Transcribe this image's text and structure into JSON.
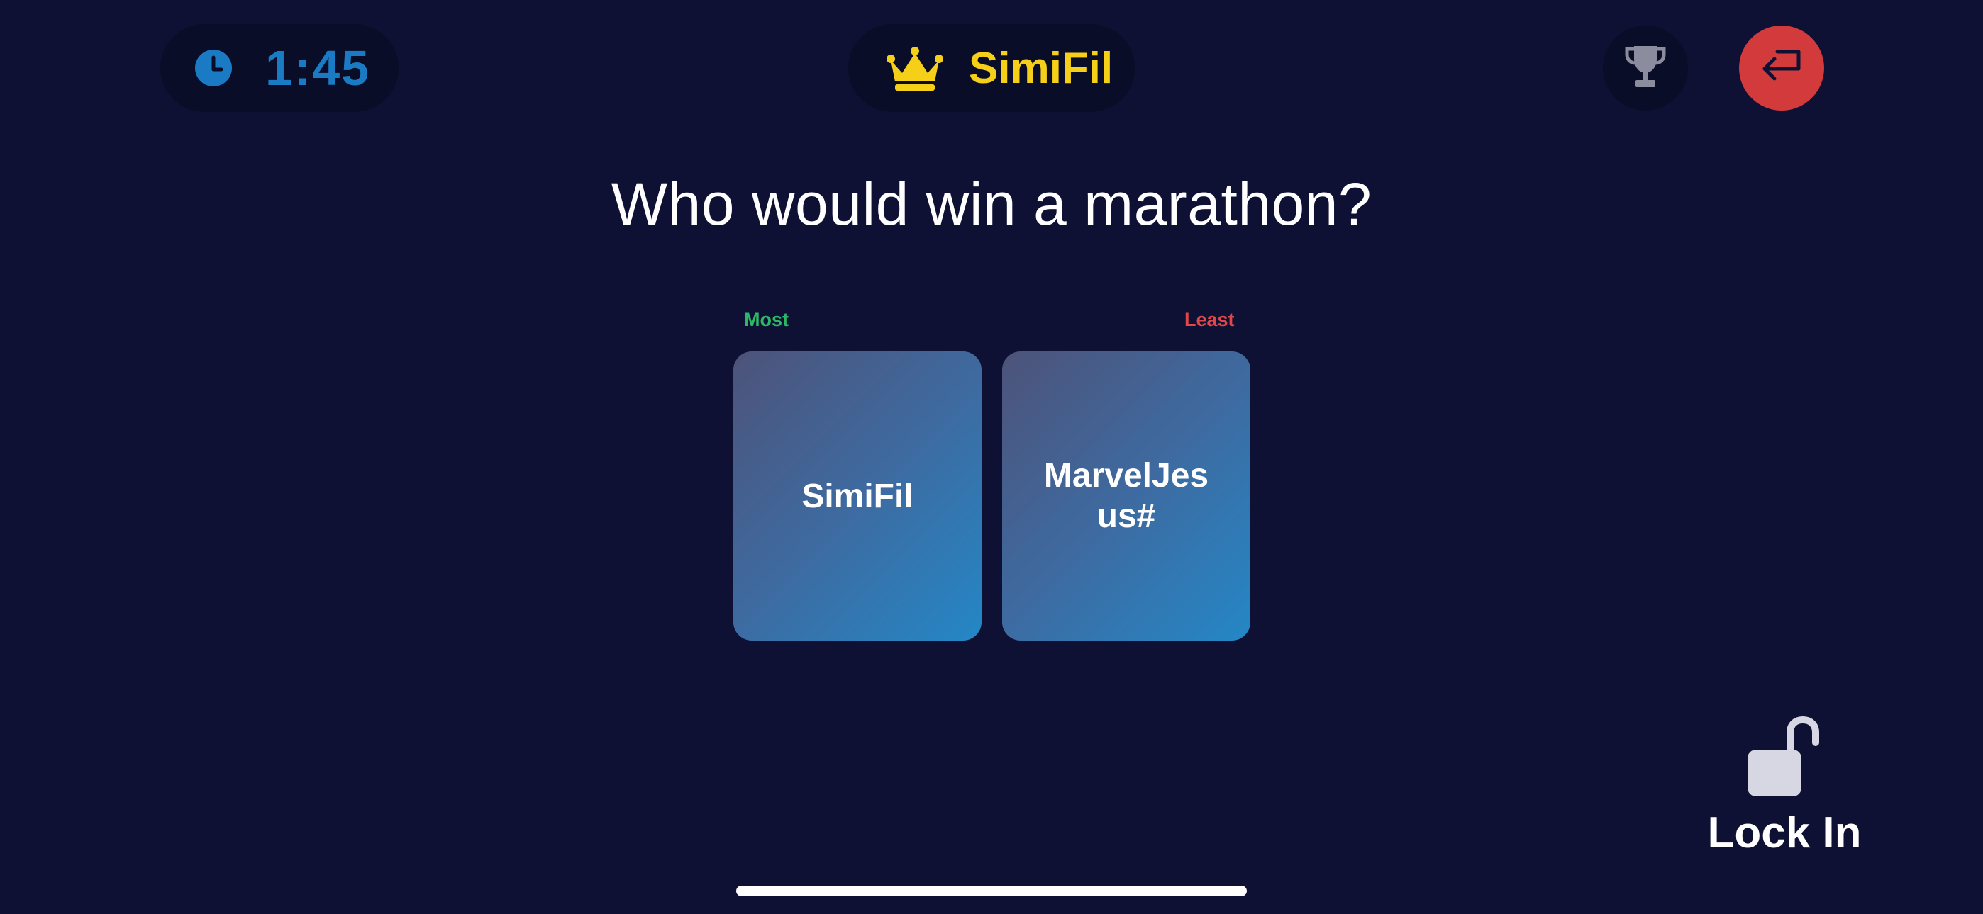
{
  "timer": {
    "icon": "clock-icon",
    "value": "1:45",
    "color": "#1a7bc4"
  },
  "header": {
    "icon": "crown-icon",
    "title": "SimiFil",
    "title_color": "#f6cf18"
  },
  "actions": {
    "trophy_icon": "trophy-icon",
    "exit_icon": "exit-arrow-icon",
    "exit_color": "#d33a3c"
  },
  "question": "Who would win a marathon?",
  "scale": {
    "most_label": "Most",
    "most_color": "#2cb866",
    "least_label": "Least",
    "least_color": "#e0474a"
  },
  "cards": [
    {
      "name": "SimiFil"
    },
    {
      "name": "MarvelJesus#"
    }
  ],
  "lock_in": {
    "icon": "unlock-icon",
    "label": "Lock In"
  },
  "background_color": "#0e1133"
}
